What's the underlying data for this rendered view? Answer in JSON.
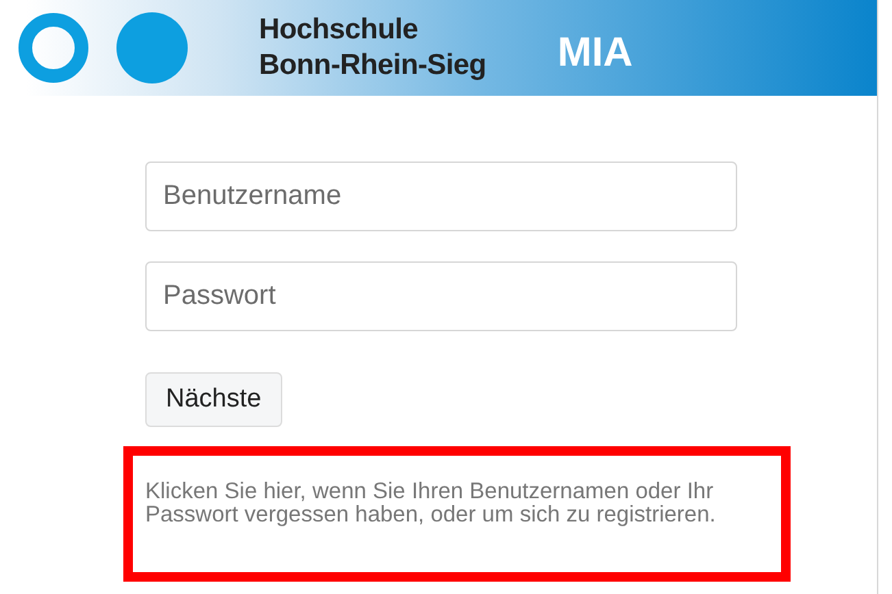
{
  "header": {
    "school_name_line1": "Hochschule",
    "school_name_line2": "Bonn-Rhein-Sieg",
    "app_name": "MIA"
  },
  "fields": [
    {
      "placeholder": "Benutzername"
    },
    {
      "placeholder": "Passwort"
    }
  ],
  "button": {
    "label": "Nächste"
  },
  "help_text": {
    "text": "Klicken Sie hier, wenn Sie Ihren Benutzernamen oder Ihr Passwort vergessen haben, oder um sich zu registrieren.",
    "highlighted": true
  }
}
